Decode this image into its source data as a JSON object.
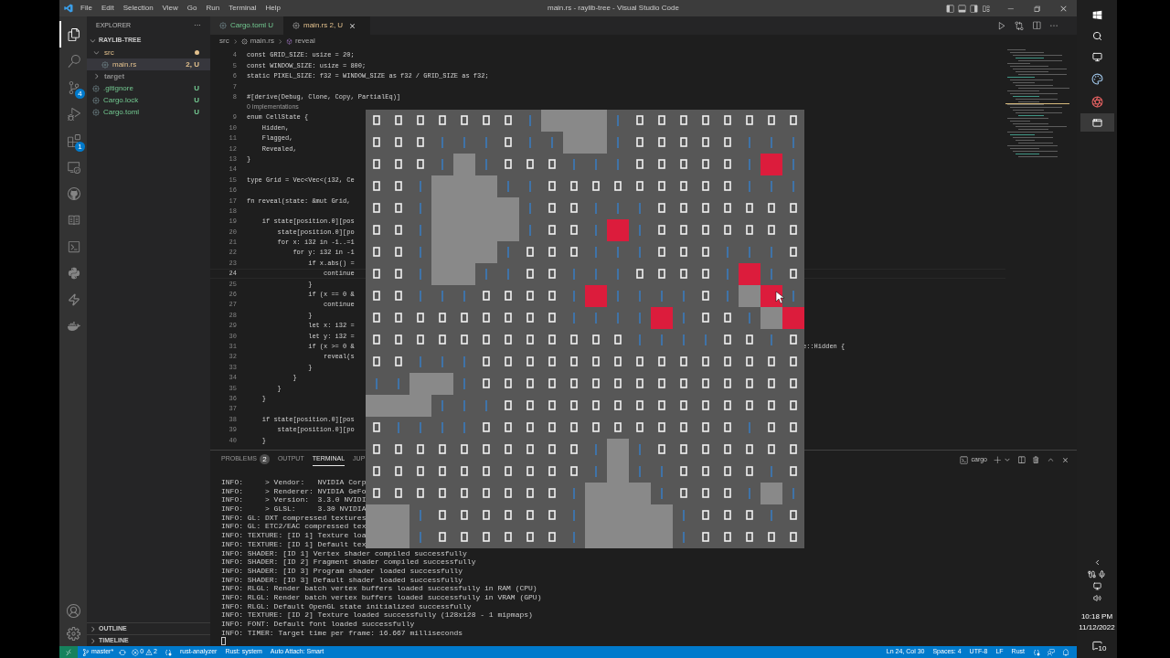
{
  "window": {
    "title": "main.rs - raylib-tree - Visual Studio Code",
    "menu": [
      "File",
      "Edit",
      "Selection",
      "View",
      "Go",
      "Run",
      "Terminal",
      "Help"
    ]
  },
  "activity_bar": {
    "items": [
      {
        "selected": true
      },
      {
        "selected": false
      },
      {
        "selected": false,
        "badge": "4"
      },
      {
        "selected": false
      },
      {
        "selected": false,
        "badge": "1"
      },
      {
        "selected": false
      },
      {
        "selected": false
      },
      {
        "selected": false
      },
      {
        "selected": false
      },
      {
        "selected": false
      },
      {
        "selected": false
      },
      {
        "selected": false
      }
    ]
  },
  "sidebar": {
    "title": "EXPLORER",
    "more": "···",
    "project": "RAYLIB-TREE",
    "tree": [
      {
        "label": "src",
        "kind": "folder",
        "expanded": true,
        "selected": false,
        "color": "#e2c08d",
        "children": [
          {
            "label": "main.rs",
            "kind": "file",
            "selected": true,
            "color": "#e2c08d",
            "decoration": "2, U"
          }
        ]
      },
      {
        "label": "target",
        "kind": "folder",
        "expanded": false,
        "selected": false,
        "color": "#8c8c8c"
      },
      {
        "label": ".gitignore",
        "kind": "file",
        "selected": false,
        "color": "#73c991",
        "decoration": "U"
      },
      {
        "label": "Cargo.lock",
        "kind": "file",
        "selected": false,
        "color": "#73c991",
        "decoration": "U"
      },
      {
        "label": "Cargo.toml",
        "kind": "file",
        "selected": false,
        "color": "#73c991",
        "decoration": "U"
      }
    ],
    "sections": [
      "OUTLINE",
      "TIMELINE"
    ]
  },
  "tabs": [
    {
      "label": "Cargo.toml",
      "decoration": "U",
      "selected": false
    },
    {
      "label": "main.rs",
      "decoration": "2, U",
      "selected": true
    }
  ],
  "breadcrumb": [
    "src",
    "main.rs",
    "reveal"
  ],
  "editor": {
    "code_lens": "0 implementations",
    "lines": [
      {
        "number": "4",
        "text": "const GRID_SIZE: usize = 20;",
        "current": false
      },
      {
        "number": "5",
        "text": "const WINDOW_SIZE: usize = 800;",
        "current": false
      },
      {
        "number": "6",
        "text": "static PIXEL_SIZE: f32 = WINDOW_SIZE as f32 / GRID_SIZE as f32;",
        "current": false
      },
      {
        "number": "7",
        "current": false
      },
      {
        "number": "8",
        "text": "#[derive(Debug, Clone, Copy, PartialEq)]",
        "current": false,
        "lens": true
      },
      {
        "number": "9",
        "text": "enum CellState {",
        "current": false
      },
      {
        "number": "10",
        "text": "    Hidden,",
        "current": false
      },
      {
        "number": "11",
        "text": "    Flagged,",
        "current": false
      },
      {
        "number": "12",
        "text": "    Revealed,",
        "current": false
      },
      {
        "number": "13",
        "text": "}",
        "current": false
      },
      {
        "number": "14",
        "current": false
      },
      {
        "number": "15",
        "text": "type Grid = Vec<Vec<(i32, Ce",
        "current": false
      },
      {
        "number": "16",
        "current": false
      },
      {
        "number": "17",
        "text": "fn reveal(state: &mut Grid,",
        "current": false
      },
      {
        "number": "18",
        "current": false
      },
      {
        "number": "19",
        "text": "    if state[position.0][pos",
        "current": false
      },
      {
        "number": "20",
        "text": "        state[position.0][po",
        "current": false
      },
      {
        "number": "21",
        "text": "        for x: i32 in -1..=1",
        "current": false
      },
      {
        "number": "22",
        "text": "            for y: i32 in -1",
        "current": false
      },
      {
        "number": "23",
        "text": "                if x.abs() =",
        "current": false
      },
      {
        "number": "24",
        "text": "                    continue",
        "current": true
      },
      {
        "number": "25",
        "text": "                }",
        "current": false
      },
      {
        "number": "26",
        "text": "                if (x == 0 &",
        "current": false
      },
      {
        "number": "27",
        "text": "                    continue",
        "current": false
      },
      {
        "number": "28",
        "text": "                }",
        "current": false
      },
      {
        "number": "29",
        "text": "                let x: i32 =",
        "current": false
      },
      {
        "number": "30",
        "text": "                let y: i32 =",
        "current": false
      },
      {
        "number": "31",
        "text": "                if (x >= 0 &",
        "tail": "e::Hidden {",
        "current": false
      },
      {
        "number": "32",
        "text": "                    reveal(s",
        "current": false
      },
      {
        "number": "33",
        "text": "                }",
        "current": false
      },
      {
        "number": "34",
        "text": "            }",
        "current": false
      },
      {
        "number": "35",
        "text": "        }",
        "current": false
      },
      {
        "number": "36",
        "text": "    }",
        "current": false
      },
      {
        "number": "37",
        "current": false
      },
      {
        "number": "38",
        "text": "    if state[position.0][pos",
        "current": false
      },
      {
        "number": "39",
        "text": "        state[position.0][po",
        "current": false
      },
      {
        "number": "40",
        "text": "    }",
        "current": false
      }
    ]
  },
  "panel": {
    "tabs": [
      {
        "label": "PROBLEMS",
        "badge": "2",
        "selected": false
      },
      {
        "label": "OUTPUT",
        "selected": false
      },
      {
        "label": "TERMINAL",
        "selected": true
      },
      {
        "label": "JUP",
        "selected": false
      }
    ],
    "terminal_name": "cargo",
    "lines": [
      "INFO:     > Vendor:   NVIDIA Corp",
      "INFO:     > Renderer: NVIDIA GeFo",
      "INFO:     > Version:  3.3.0 NVIDI",
      "INFO:     > GLSL:     3.30 NVIDIA",
      "INFO: GL: DXT compressed textures",
      "INFO: GL: ETC2/EAC compressed tex",
      "INFO: TEXTURE: [ID 1] Texture loa",
      "INFO: TEXTURE: [ID 1] Default tex",
      "INFO: SHADER: [ID 1] Vertex shader compiled successfully",
      "INFO: SHADER: [ID 2] Fragment shader compiled successfully",
      "INFO: SHADER: [ID 3] Program shader loaded successfully",
      "INFO: SHADER: [ID 3] Default shader loaded successfully",
      "INFO: RLGL: Render batch vertex buffers loaded successfully in RAM (CPU)",
      "INFO: RLGL: Render batch vertex buffers loaded successfully in VRAM (GPU)",
      "INFO: RLGL: Default OpenGL state initialized successfully",
      "INFO: TEXTURE: [ID 2] Texture loaded successfully (128x128 - 1 mipmaps)",
      "INFO: FONT: Default font loaded successfully",
      "INFO: TIMER: Target time per frame: 16.667 milliseconds"
    ]
  },
  "game": {
    "rows": [
      [
        {
          "kind": "hidden"
        },
        {
          "kind": "hidden"
        },
        {
          "kind": "hidden"
        },
        {
          "kind": "hidden"
        },
        {
          "kind": "hidden"
        },
        {
          "kind": "hidden"
        },
        {
          "kind": "hidden"
        },
        {
          "kind": "open"
        },
        {
          "kind": "block"
        },
        {
          "kind": "block"
        },
        {
          "kind": "block"
        },
        {
          "kind": "open"
        },
        {
          "kind": "hidden"
        },
        {
          "kind": "hidden"
        },
        {
          "kind": "hidden"
        },
        {
          "kind": "hidden"
        },
        {
          "kind": "hidden"
        },
        {
          "kind": "hidden"
        },
        {
          "kind": "hidden"
        },
        {
          "kind": "hidden"
        }
      ],
      [
        {
          "kind": "hidden"
        },
        {
          "kind": "hidden"
        },
        {
          "kind": "hidden"
        },
        {
          "kind": "open"
        },
        {
          "kind": "open"
        },
        {
          "kind": "open"
        },
        {
          "kind": "hidden"
        },
        {
          "kind": "open"
        },
        {
          "kind": "open"
        },
        {
          "kind": "block"
        },
        {
          "kind": "block"
        },
        {
          "kind": "open"
        },
        {
          "kind": "hidden"
        },
        {
          "kind": "hidden"
        },
        {
          "kind": "hidden"
        },
        {
          "kind": "hidden"
        },
        {
          "kind": "hidden"
        },
        {
          "kind": "open"
        },
        {
          "kind": "open"
        },
        {
          "kind": "open"
        }
      ],
      [
        {
          "kind": "hidden"
        },
        {
          "kind": "hidden"
        },
        {
          "kind": "hidden"
        },
        {
          "kind": "open"
        },
        {
          "kind": "block"
        },
        {
          "kind": "open"
        },
        {
          "kind": "hidden"
        },
        {
          "kind": "hidden"
        },
        {
          "kind": "hidden"
        },
        {
          "kind": "open"
        },
        {
          "kind": "open"
        },
        {
          "kind": "open"
        },
        {
          "kind": "hidden"
        },
        {
          "kind": "hidden"
        },
        {
          "kind": "hidden"
        },
        {
          "kind": "hidden"
        },
        {
          "kind": "hidden"
        },
        {
          "kind": "open"
        },
        {
          "kind": "flag"
        },
        {
          "kind": "open"
        }
      ],
      [
        {
          "kind": "hidden"
        },
        {
          "kind": "hidden"
        },
        {
          "kind": "open"
        },
        {
          "kind": "block"
        },
        {
          "kind": "block"
        },
        {
          "kind": "block"
        },
        {
          "kind": "open"
        },
        {
          "kind": "open"
        },
        {
          "kind": "hidden"
        },
        {
          "kind": "hidden"
        },
        {
          "kind": "hidden"
        },
        {
          "kind": "hidden"
        },
        {
          "kind": "hidden"
        },
        {
          "kind": "hidden"
        },
        {
          "kind": "hidden"
        },
        {
          "kind": "hidden"
        },
        {
          "kind": "hidden"
        },
        {
          "kind": "open"
        },
        {
          "kind": "open"
        },
        {
          "kind": "open"
        }
      ],
      [
        {
          "kind": "hidden"
        },
        {
          "kind": "hidden"
        },
        {
          "kind": "open"
        },
        {
          "kind": "block"
        },
        {
          "kind": "block"
        },
        {
          "kind": "block"
        },
        {
          "kind": "block"
        },
        {
          "kind": "open"
        },
        {
          "kind": "hidden"
        },
        {
          "kind": "hidden"
        },
        {
          "kind": "open"
        },
        {
          "kind": "open"
        },
        {
          "kind": "open"
        },
        {
          "kind": "hidden"
        },
        {
          "kind": "hidden"
        },
        {
          "kind": "hidden"
        },
        {
          "kind": "hidden"
        },
        {
          "kind": "hidden"
        },
        {
          "kind": "hidden"
        },
        {
          "kind": "hidden"
        }
      ],
      [
        {
          "kind": "hidden"
        },
        {
          "kind": "hidden"
        },
        {
          "kind": "open"
        },
        {
          "kind": "block"
        },
        {
          "kind": "block"
        },
        {
          "kind": "block"
        },
        {
          "kind": "block"
        },
        {
          "kind": "open"
        },
        {
          "kind": "hidden"
        },
        {
          "kind": "hidden"
        },
        {
          "kind": "open"
        },
        {
          "kind": "flag"
        },
        {
          "kind": "open"
        },
        {
          "kind": "hidden"
        },
        {
          "kind": "hidden"
        },
        {
          "kind": "hidden"
        },
        {
          "kind": "hidden"
        },
        {
          "kind": "hidden"
        },
        {
          "kind": "hidden"
        },
        {
          "kind": "hidden"
        }
      ],
      [
        {
          "kind": "hidden"
        },
        {
          "kind": "hidden"
        },
        {
          "kind": "open"
        },
        {
          "kind": "block"
        },
        {
          "kind": "block"
        },
        {
          "kind": "block"
        },
        {
          "kind": "open"
        },
        {
          "kind": "hidden"
        },
        {
          "kind": "hidden"
        },
        {
          "kind": "hidden"
        },
        {
          "kind": "open"
        },
        {
          "kind": "open"
        },
        {
          "kind": "open"
        },
        {
          "kind": "hidden"
        },
        {
          "kind": "hidden"
        },
        {
          "kind": "hidden"
        },
        {
          "kind": "open"
        },
        {
          "kind": "open"
        },
        {
          "kind": "open"
        },
        {
          "kind": "hidden"
        }
      ],
      [
        {
          "kind": "hidden"
        },
        {
          "kind": "hidden"
        },
        {
          "kind": "open"
        },
        {
          "kind": "block"
        },
        {
          "kind": "block"
        },
        {
          "kind": "open"
        },
        {
          "kind": "open"
        },
        {
          "kind": "hidden"
        },
        {
          "kind": "hidden"
        },
        {
          "kind": "open"
        },
        {
          "kind": "open"
        },
        {
          "kind": "open"
        },
        {
          "kind": "hidden"
        },
        {
          "kind": "hidden"
        },
        {
          "kind": "hidden"
        },
        {
          "kind": "hidden"
        },
        {
          "kind": "open"
        },
        {
          "kind": "flag"
        },
        {
          "kind": "open"
        },
        {
          "kind": "hidden"
        }
      ],
      [
        {
          "kind": "hidden"
        },
        {
          "kind": "hidden"
        },
        {
          "kind": "open"
        },
        {
          "kind": "open"
        },
        {
          "kind": "open"
        },
        {
          "kind": "hidden"
        },
        {
          "kind": "hidden"
        },
        {
          "kind": "hidden"
        },
        {
          "kind": "hidden"
        },
        {
          "kind": "open"
        },
        {
          "kind": "flag"
        },
        {
          "kind": "open"
        },
        {
          "kind": "open"
        },
        {
          "kind": "open"
        },
        {
          "kind": "open"
        },
        {
          "kind": "hidden"
        },
        {
          "kind": "open"
        },
        {
          "kind": "block"
        },
        {
          "kind": "flag"
        },
        {
          "kind": "open"
        }
      ],
      [
        {
          "kind": "hidden"
        },
        {
          "kind": "hidden"
        },
        {
          "kind": "hidden"
        },
        {
          "kind": "hidden"
        },
        {
          "kind": "hidden"
        },
        {
          "kind": "hidden"
        },
        {
          "kind": "hidden"
        },
        {
          "kind": "hidden"
        },
        {
          "kind": "hidden"
        },
        {
          "kind": "open"
        },
        {
          "kind": "open"
        },
        {
          "kind": "open"
        },
        {
          "kind": "open"
        },
        {
          "kind": "flag"
        },
        {
          "kind": "open"
        },
        {
          "kind": "hidden"
        },
        {
          "kind": "hidden"
        },
        {
          "kind": "open"
        },
        {
          "kind": "block"
        },
        {
          "kind": "flag"
        }
      ],
      [
        {
          "kind": "hidden"
        },
        {
          "kind": "hidden"
        },
        {
          "kind": "hidden"
        },
        {
          "kind": "hidden"
        },
        {
          "kind": "hidden"
        },
        {
          "kind": "hidden"
        },
        {
          "kind": "hidden"
        },
        {
          "kind": "hidden"
        },
        {
          "kind": "hidden"
        },
        {
          "kind": "hidden"
        },
        {
          "kind": "hidden"
        },
        {
          "kind": "hidden"
        },
        {
          "kind": "open"
        },
        {
          "kind": "open"
        },
        {
          "kind": "open"
        },
        {
          "kind": "open"
        },
        {
          "kind": "hidden"
        },
        {
          "kind": "hidden"
        },
        {
          "kind": "open"
        },
        {
          "kind": "hidden"
        }
      ],
      [
        {
          "kind": "hidden"
        },
        {
          "kind": "hidden"
        },
        {
          "kind": "open"
        },
        {
          "kind": "open"
        },
        {
          "kind": "open"
        },
        {
          "kind": "hidden"
        },
        {
          "kind": "hidden"
        },
        {
          "kind": "hidden"
        },
        {
          "kind": "hidden"
        },
        {
          "kind": "hidden"
        },
        {
          "kind": "hidden"
        },
        {
          "kind": "hidden"
        },
        {
          "kind": "hidden"
        },
        {
          "kind": "hidden"
        },
        {
          "kind": "hidden"
        },
        {
          "kind": "hidden"
        },
        {
          "kind": "hidden"
        },
        {
          "kind": "hidden"
        },
        {
          "kind": "hidden"
        },
        {
          "kind": "hidden"
        }
      ],
      [
        {
          "kind": "open"
        },
        {
          "kind": "open"
        },
        {
          "kind": "block"
        },
        {
          "kind": "block"
        },
        {
          "kind": "open"
        },
        {
          "kind": "hidden"
        },
        {
          "kind": "hidden"
        },
        {
          "kind": "hidden"
        },
        {
          "kind": "hidden"
        },
        {
          "kind": "hidden"
        },
        {
          "kind": "hidden"
        },
        {
          "kind": "hidden"
        },
        {
          "kind": "hidden"
        },
        {
          "kind": "hidden"
        },
        {
          "kind": "hidden"
        },
        {
          "kind": "hidden"
        },
        {
          "kind": "hidden"
        },
        {
          "kind": "hidden"
        },
        {
          "kind": "hidden"
        },
        {
          "kind": "hidden"
        }
      ],
      [
        {
          "kind": "block"
        },
        {
          "kind": "block"
        },
        {
          "kind": "block"
        },
        {
          "kind": "open"
        },
        {
          "kind": "open"
        },
        {
          "kind": "open"
        },
        {
          "kind": "hidden"
        },
        {
          "kind": "hidden"
        },
        {
          "kind": "hidden"
        },
        {
          "kind": "hidden"
        },
        {
          "kind": "hidden"
        },
        {
          "kind": "hidden"
        },
        {
          "kind": "hidden"
        },
        {
          "kind": "hidden"
        },
        {
          "kind": "hidden"
        },
        {
          "kind": "hidden"
        },
        {
          "kind": "hidden"
        },
        {
          "kind": "hidden"
        },
        {
          "kind": "hidden"
        },
        {
          "kind": "hidden"
        }
      ],
      [
        {
          "kind": "hidden"
        },
        {
          "kind": "open"
        },
        {
          "kind": "open"
        },
        {
          "kind": "open"
        },
        {
          "kind": "open"
        },
        {
          "kind": "hidden"
        },
        {
          "kind": "hidden"
        },
        {
          "kind": "hidden"
        },
        {
          "kind": "hidden"
        },
        {
          "kind": "hidden"
        },
        {
          "kind": "hidden"
        },
        {
          "kind": "hidden"
        },
        {
          "kind": "hidden"
        },
        {
          "kind": "hidden"
        },
        {
          "kind": "hidden"
        },
        {
          "kind": "hidden"
        },
        {
          "kind": "hidden"
        },
        {
          "kind": "open"
        },
        {
          "kind": "hidden"
        },
        {
          "kind": "hidden"
        }
      ],
      [
        {
          "kind": "hidden"
        },
        {
          "kind": "hidden"
        },
        {
          "kind": "hidden"
        },
        {
          "kind": "hidden"
        },
        {
          "kind": "hidden"
        },
        {
          "kind": "hidden"
        },
        {
          "kind": "hidden"
        },
        {
          "kind": "hidden"
        },
        {
          "kind": "hidden"
        },
        {
          "kind": "hidden"
        },
        {
          "kind": "open"
        },
        {
          "kind": "block"
        },
        {
          "kind": "open"
        },
        {
          "kind": "hidden"
        },
        {
          "kind": "hidden"
        },
        {
          "kind": "hidden"
        },
        {
          "kind": "hidden"
        },
        {
          "kind": "hidden"
        },
        {
          "kind": "hidden"
        },
        {
          "kind": "hidden"
        }
      ],
      [
        {
          "kind": "hidden"
        },
        {
          "kind": "hidden"
        },
        {
          "kind": "hidden"
        },
        {
          "kind": "hidden"
        },
        {
          "kind": "hidden"
        },
        {
          "kind": "hidden"
        },
        {
          "kind": "hidden"
        },
        {
          "kind": "hidden"
        },
        {
          "kind": "hidden"
        },
        {
          "kind": "hidden"
        },
        {
          "kind": "open"
        },
        {
          "kind": "block"
        },
        {
          "kind": "open"
        },
        {
          "kind": "open"
        },
        {
          "kind": "hidden"
        },
        {
          "kind": "hidden"
        },
        {
          "kind": "hidden"
        },
        {
          "kind": "hidden"
        },
        {
          "kind": "open"
        },
        {
          "kind": "hidden"
        }
      ],
      [
        {
          "kind": "hidden"
        },
        {
          "kind": "hidden"
        },
        {
          "kind": "hidden"
        },
        {
          "kind": "hidden"
        },
        {
          "kind": "hidden"
        },
        {
          "kind": "hidden"
        },
        {
          "kind": "hidden"
        },
        {
          "kind": "hidden"
        },
        {
          "kind": "hidden"
        },
        {
          "kind": "open"
        },
        {
          "kind": "block"
        },
        {
          "kind": "block"
        },
        {
          "kind": "block"
        },
        {
          "kind": "open"
        },
        {
          "kind": "hidden"
        },
        {
          "kind": "hidden"
        },
        {
          "kind": "hidden"
        },
        {
          "kind": "open"
        },
        {
          "kind": "block"
        },
        {
          "kind": "open"
        }
      ],
      [
        {
          "kind": "block"
        },
        {
          "kind": "block"
        },
        {
          "kind": "open"
        },
        {
          "kind": "hidden"
        },
        {
          "kind": "hidden"
        },
        {
          "kind": "hidden"
        },
        {
          "kind": "hidden"
        },
        {
          "kind": "hidden"
        },
        {
          "kind": "hidden"
        },
        {
          "kind": "open"
        },
        {
          "kind": "block"
        },
        {
          "kind": "block"
        },
        {
          "kind": "block"
        },
        {
          "kind": "block"
        },
        {
          "kind": "open"
        },
        {
          "kind": "hidden"
        },
        {
          "kind": "hidden"
        },
        {
          "kind": "hidden"
        },
        {
          "kind": "open"
        },
        {
          "kind": "hidden"
        }
      ],
      [
        {
          "kind": "block"
        },
        {
          "kind": "block"
        },
        {
          "kind": "open"
        },
        {
          "kind": "hidden"
        },
        {
          "kind": "hidden"
        },
        {
          "kind": "hidden"
        },
        {
          "kind": "hidden"
        },
        {
          "kind": "hidden"
        },
        {
          "kind": "hidden"
        },
        {
          "kind": "open"
        },
        {
          "kind": "block"
        },
        {
          "kind": "block"
        },
        {
          "kind": "block"
        },
        {
          "kind": "block"
        },
        {
          "kind": "open"
        },
        {
          "kind": "hidden"
        },
        {
          "kind": "hidden"
        },
        {
          "kind": "hidden"
        },
        {
          "kind": "hidden"
        },
        {
          "kind": "hidden"
        }
      ]
    ]
  },
  "status_bar": {
    "branch": "master*",
    "errors": "0",
    "warnings": "2",
    "left": [
      "rust-analyzer",
      "Rust: system",
      "Auto Attach: Smart"
    ],
    "right": [
      "Ln 24, Col 30",
      "Spaces: 4",
      "UTF-8",
      "LF",
      "Rust"
    ]
  },
  "taskbar": {
    "time": "10:18 PM",
    "date": "11/12/2022",
    "notifications": "10"
  }
}
